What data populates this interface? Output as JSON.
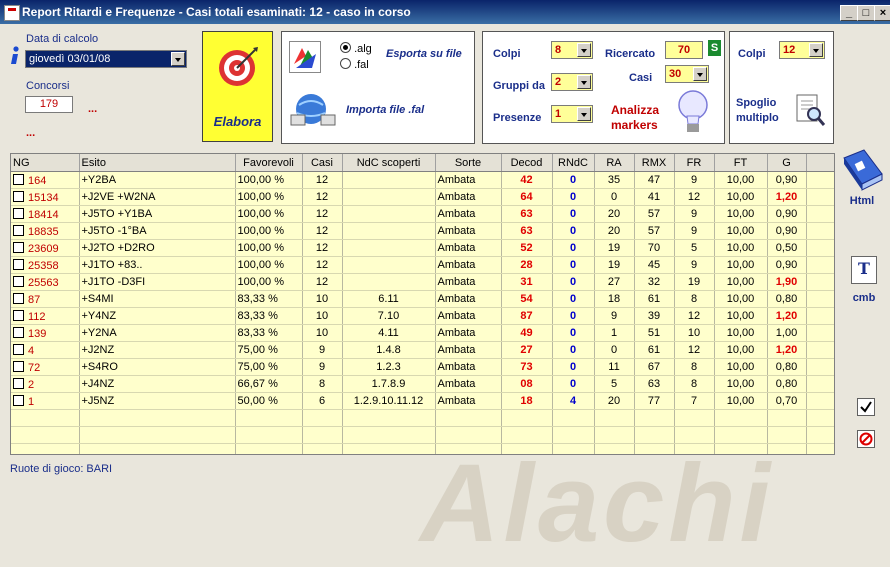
{
  "window": {
    "title": "Report Ritardi e Frequenze - Casi totali esaminati: 12 - caso in corso",
    "btn_min": "_",
    "btn_max": "□",
    "btn_close": "×"
  },
  "left": {
    "date_label": "Data di calcolo",
    "date_value": "giovedì 03/01/08",
    "concorsi_label": "Concorsi",
    "concorsi_value": "179",
    "dots1": "...",
    "dots2": "..."
  },
  "elabora": {
    "label": "Elabora"
  },
  "file_panel": {
    "opt_alg": ".alg",
    "opt_fal": ".fal",
    "export_label": "Esporta su file",
    "import_label": "Importa file .fal"
  },
  "markers_panel": {
    "colpi_label": "Colpi",
    "colpi_value": "8",
    "ricercato_label": "Ricercato",
    "ricercato_value": "70",
    "s_badge": "S",
    "gruppi_label": "Gruppi da",
    "gruppi_value": "2",
    "casi_label": "Casi",
    "casi_value": "30",
    "presenze_label": "Presenze",
    "presenze_value": "1",
    "analizza_label": "Analizza markers"
  },
  "spoglio_panel": {
    "colpi_label": "Colpi",
    "colpi_value": "12",
    "spoglio_label": "Spoglio multiplo"
  },
  "table": {
    "headers": [
      "NG",
      "Esito",
      "Favorevoli",
      "Casi",
      "NdC scoperti",
      "Sorte",
      "Decod",
      "RNdC",
      "RA",
      "RMX",
      "FR",
      "FT",
      "G"
    ],
    "rows": [
      {
        "ng": "164",
        "esito": "+Y2BA",
        "fav": "100,00 %",
        "casi": "12",
        "ndc": "",
        "sorte": "Ambata",
        "decod": "42",
        "rndc": "0",
        "ra": "35",
        "rmx": "47",
        "fr": "9",
        "ft": "10,00",
        "g": "0,90",
        "g_red": false
      },
      {
        "ng": "15134",
        "esito": "+J2VE +W2NA",
        "fav": "100,00 %",
        "casi": "12",
        "ndc": "",
        "sorte": "Ambata",
        "decod": "64",
        "rndc": "0",
        "ra": "0",
        "rmx": "41",
        "fr": "12",
        "ft": "10,00",
        "g": "1,20",
        "g_red": true
      },
      {
        "ng": "18414",
        "esito": "+J5TO +Y1BA",
        "fav": "100,00 %",
        "casi": "12",
        "ndc": "",
        "sorte": "Ambata",
        "decod": "63",
        "rndc": "0",
        "ra": "20",
        "rmx": "57",
        "fr": "9",
        "ft": "10,00",
        "g": "0,90",
        "g_red": false
      },
      {
        "ng": "18835",
        "esito": "+J5TO -1°BA",
        "fav": "100,00 %",
        "casi": "12",
        "ndc": "",
        "sorte": "Ambata",
        "decod": "63",
        "rndc": "0",
        "ra": "20",
        "rmx": "57",
        "fr": "9",
        "ft": "10,00",
        "g": "0,90",
        "g_red": false
      },
      {
        "ng": "23609",
        "esito": "+J2TO +D2RO",
        "fav": "100,00 %",
        "casi": "12",
        "ndc": "",
        "sorte": "Ambata",
        "decod": "52",
        "rndc": "0",
        "ra": "19",
        "rmx": "70",
        "fr": "5",
        "ft": "10,00",
        "g": "0,50",
        "g_red": false
      },
      {
        "ng": "25358",
        "esito": "+J1TO +83..",
        "fav": "100,00 %",
        "casi": "12",
        "ndc": "",
        "sorte": "Ambata",
        "decod": "28",
        "rndc": "0",
        "ra": "19",
        "rmx": "45",
        "fr": "9",
        "ft": "10,00",
        "g": "0,90",
        "g_red": false
      },
      {
        "ng": "25563",
        "esito": "+J1TO -D3FI",
        "fav": "100,00 %",
        "casi": "12",
        "ndc": "",
        "sorte": "Ambata",
        "decod": "31",
        "rndc": "0",
        "ra": "27",
        "rmx": "32",
        "fr": "19",
        "ft": "10,00",
        "g": "1,90",
        "g_red": true
      },
      {
        "ng": "87",
        "esito": "+S4MI",
        "fav": "83,33 %",
        "casi": "10",
        "ndc": "6.11",
        "sorte": "Ambata",
        "decod": "54",
        "rndc": "0",
        "ra": "18",
        "rmx": "61",
        "fr": "8",
        "ft": "10,00",
        "g": "0,80",
        "g_red": false
      },
      {
        "ng": "112",
        "esito": "+Y4NZ",
        "fav": "83,33 %",
        "casi": "10",
        "ndc": "7.10",
        "sorte": "Ambata",
        "decod": "87",
        "rndc": "0",
        "ra": "9",
        "rmx": "39",
        "fr": "12",
        "ft": "10,00",
        "g": "1,20",
        "g_red": true
      },
      {
        "ng": "139",
        "esito": "+Y2NA",
        "fav": "83,33 %",
        "casi": "10",
        "ndc": "4.11",
        "sorte": "Ambata",
        "decod": "49",
        "rndc": "0",
        "ra": "1",
        "rmx": "51",
        "fr": "10",
        "ft": "10,00",
        "g": "1,00",
        "g_red": false
      },
      {
        "ng": "4",
        "esito": "+J2NZ",
        "fav": "75,00 %",
        "casi": "9",
        "ndc": "1.4.8",
        "sorte": "Ambata",
        "decod": "27",
        "rndc": "0",
        "ra": "0",
        "rmx": "61",
        "fr": "12",
        "ft": "10,00",
        "g": "1,20",
        "g_red": true
      },
      {
        "ng": "72",
        "esito": "+S4RO",
        "fav": "75,00 %",
        "casi": "9",
        "ndc": "1.2.3",
        "sorte": "Ambata",
        "decod": "73",
        "rndc": "0",
        "ra": "11",
        "rmx": "67",
        "fr": "8",
        "ft": "10,00",
        "g": "0,80",
        "g_red": false
      },
      {
        "ng": "2",
        "esito": "+J4NZ",
        "fav": "66,67 %",
        "casi": "8",
        "ndc": "1.7.8.9",
        "sorte": "Ambata",
        "decod": "08",
        "rndc": "0",
        "ra": "5",
        "rmx": "63",
        "fr": "8",
        "ft": "10,00",
        "g": "0,80",
        "g_red": false
      },
      {
        "ng": "1",
        "esito": "+J5NZ",
        "fav": "50,00 %",
        "casi": "6",
        "ndc": "1.2.9.10.11.12",
        "sorte": "Ambata",
        "decod": "18",
        "rndc": "4",
        "ra": "20",
        "rmx": "77",
        "fr": "7",
        "ft": "10,00",
        "g": "0,70",
        "g_red": false
      }
    ],
    "empty_rows": 4
  },
  "side": {
    "html_label": "Html",
    "cmb_label": "cmb"
  },
  "footer": {
    "ruote_label": "Ruote di gioco: BARI"
  },
  "watermark": "Alachi"
}
